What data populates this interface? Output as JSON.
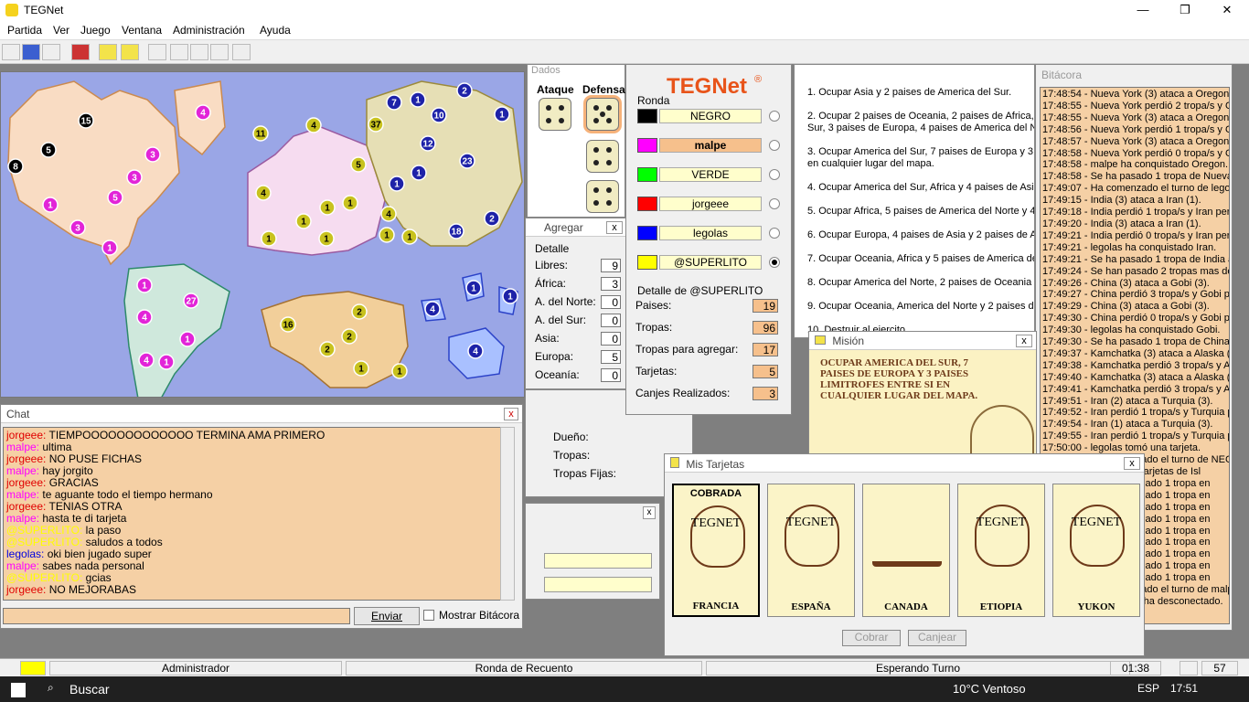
{
  "window": {
    "title": "TEGNet",
    "minimize": "—",
    "restore": "❐",
    "close": "✕"
  },
  "menu": [
    "Partida",
    "Ver",
    "Juego",
    "Ventana",
    "Administración",
    "Ayuda"
  ],
  "map": {
    "countries": [
      {
        "n": "15",
        "c": "black"
      },
      {
        "n": "5",
        "c": "black"
      },
      {
        "n": "8",
        "c": "black"
      },
      {
        "n": "4",
        "c": "magenta"
      },
      {
        "n": "3",
        "c": "magenta"
      },
      {
        "n": "3",
        "c": "magenta"
      },
      {
        "n": "5",
        "c": "magenta"
      },
      {
        "n": "1",
        "c": "magenta"
      },
      {
        "n": "3",
        "c": "magenta"
      },
      {
        "n": "1",
        "c": "magenta"
      },
      {
        "n": "1",
        "c": "magenta"
      },
      {
        "n": "27",
        "c": "magenta"
      },
      {
        "n": "4",
        "c": "magenta"
      },
      {
        "n": "1",
        "c": "magenta"
      },
      {
        "n": "4",
        "c": "magenta"
      },
      {
        "n": "1",
        "c": "magenta"
      },
      {
        "n": "11",
        "c": "yellow"
      },
      {
        "n": "4",
        "c": "yellow"
      },
      {
        "n": "37",
        "c": "yellow"
      },
      {
        "n": "5",
        "c": "yellow"
      },
      {
        "n": "4",
        "c": "yellow"
      },
      {
        "n": "1",
        "c": "yellow"
      },
      {
        "n": "1",
        "c": "yellow"
      },
      {
        "n": "1",
        "c": "yellow"
      },
      {
        "n": "1",
        "c": "yellow"
      },
      {
        "n": "1",
        "c": "yellow"
      },
      {
        "n": "4",
        "c": "yellow"
      },
      {
        "n": "1",
        "c": "yellow"
      },
      {
        "n": "1",
        "c": "yellow"
      },
      {
        "n": "16",
        "c": "yellow"
      },
      {
        "n": "2",
        "c": "yellow"
      },
      {
        "n": "2",
        "c": "yellow"
      },
      {
        "n": "2",
        "c": "yellow"
      },
      {
        "n": "1",
        "c": "yellow"
      },
      {
        "n": "1",
        "c": "yellow"
      },
      {
        "n": "7",
        "c": "blue"
      },
      {
        "n": "1",
        "c": "blue"
      },
      {
        "n": "2",
        "c": "blue"
      },
      {
        "n": "10",
        "c": "blue"
      },
      {
        "n": "1",
        "c": "blue"
      },
      {
        "n": "12",
        "c": "blue"
      },
      {
        "n": "23",
        "c": "blue"
      },
      {
        "n": "1",
        "c": "blue"
      },
      {
        "n": "1",
        "c": "blue"
      },
      {
        "n": "2",
        "c": "blue"
      },
      {
        "n": "18",
        "c": "blue"
      },
      {
        "n": "4",
        "c": "blue"
      },
      {
        "n": "1",
        "c": "blue"
      },
      {
        "n": "1",
        "c": "blue"
      },
      {
        "n": "4",
        "c": "blue"
      }
    ]
  },
  "chat": {
    "title": "Chat",
    "close": "x",
    "send_label": "Enviar",
    "show_log_label": "Mostrar Bitácora",
    "messages": [
      {
        "user": "jorgeee:",
        "color": "#e00000",
        "text": "TIEMPOOOOOOOOOOOOO TERMINA AMA PRIMERO"
      },
      {
        "user": "malpe:",
        "color": "#ff00ff",
        "text": "ultima"
      },
      {
        "user": "jorgeee:",
        "color": "#e00000",
        "text": "NO PUSE FICHAS"
      },
      {
        "user": "malpe:",
        "color": "#ff00ff",
        "text": "hay  jorgito"
      },
      {
        "user": "jorgeee:",
        "color": "#e00000",
        "text": "GRACIAS"
      },
      {
        "user": "malpe:",
        "color": "#ff00ff",
        "text": "te aguante todo el tiempo hermano"
      },
      {
        "user": "jorgeee:",
        "color": "#e00000",
        "text": "TENIAS OTRA"
      },
      {
        "user": "malpe:",
        "color": "#ff00ff",
        "text": "hasta te di tarjeta"
      },
      {
        "user": "@SUPERLITO:",
        "color": "#ffff00",
        "text": "la paso"
      },
      {
        "user": "@SUPERLITO:",
        "color": "#ffff00",
        "text": "saludos a todos"
      },
      {
        "user": "legolas:",
        "color": "#0000e0",
        "text": "oki bien jugado super"
      },
      {
        "user": "malpe:",
        "color": "#ff00ff",
        "text": "sabes nada personal"
      },
      {
        "user": "@SUPERLITO:",
        "color": "#ffff00",
        "text": "gcias"
      },
      {
        "user": "jorgeee:",
        "color": "#e00000",
        "text": "NO MEJORABAS"
      }
    ]
  },
  "dados": {
    "title": "Dados",
    "attack_label": "Ataque",
    "defense_label": "Defensa"
  },
  "agregar": {
    "title": "Agregar",
    "group_label": "Detalle",
    "rows": [
      {
        "label": "Libres:",
        "value": "9"
      },
      {
        "label": "África:",
        "value": "3"
      },
      {
        "label": "A. del Norte:",
        "value": "0"
      },
      {
        "label": "A. del Sur:",
        "value": "0"
      },
      {
        "label": "Asia:",
        "value": "0"
      },
      {
        "label": "Europa:",
        "value": "5"
      },
      {
        "label": "Oceanía:",
        "value": "0"
      }
    ]
  },
  "tegnet": {
    "logo": "TEGNet",
    "registered": "®",
    "ronda_label": "Ronda",
    "players": [
      {
        "name": "NEGRO",
        "color": "#000000",
        "active": false
      },
      {
        "name": "malpe",
        "color": "#ff00ff",
        "active": true
      },
      {
        "name": "VERDE",
        "color": "#00ff00",
        "active": false
      },
      {
        "name": "jorgeee",
        "color": "#ff0000",
        "active": false
      },
      {
        "name": "legolas",
        "color": "#0000ff",
        "active": false
      },
      {
        "name": "@SUPERLITO",
        "color": "#ffff00",
        "active": false
      }
    ],
    "detail_label": "Detalle de @SUPERLITO",
    "details": [
      {
        "label": "Paises:",
        "value": "19"
      },
      {
        "label": "Tropas:",
        "value": "96"
      },
      {
        "label": "Tropas para agregar:",
        "value": "17"
      },
      {
        "label": "Tarjetas:",
        "value": "5"
      },
      {
        "label": "Canjes Realizados:",
        "value": "3"
      }
    ]
  },
  "pais_panel": {
    "owner_label": "Dueño:",
    "troops_label": "Tropas:",
    "fixed_label": "Tropas Fijas:"
  },
  "objetivos": [
    "1. Ocupar Asia y 2 paises de America del Sur.",
    "2. Ocupar 2 paises de Oceania, 2 paises de Africa,",
    "Sur, 3 paises de Europa, 4 paises de America del N",
    "3. Ocupar America del Sur, 7 paises de Europa y 3 p",
    "en cualquier lugar del mapa.",
    "4. Ocupar America del Sur, Africa y 4 paises de Asia",
    "5. Ocupar Africa, 5 paises de America del Norte y 4",
    "6. Ocupar Europa, 4 paises de Asia y 2 paises de A",
    "7. Ocupar Oceania, Africa y 5 paises de America de",
    "8. Ocupar America del Norte, 2 paises de Oceania y",
    "9. Ocupar Oceania, America del Norte y 2 paises de",
    "10. Destruir al ejercito"
  ],
  "mision": {
    "title": "Misión",
    "close": "x",
    "text": "OCUPAR AMERICA DEL SUR, 7 PAISES DE EUROPA Y 3 PAISES LIMITROFES ENTRE SI EN CUALQUIER LUGAR DEL MAPA."
  },
  "tarjetas": {
    "title": "Mis Tarjetas",
    "close": "x",
    "cards": [
      {
        "name": "FRANCIA",
        "badge": "COBRADA",
        "art": "TEGNET",
        "selected": true
      },
      {
        "name": "ESPAÑA",
        "badge": "",
        "art": "TEGNET",
        "selected": false
      },
      {
        "name": "CANADA",
        "badge": "",
        "art": "",
        "selected": false
      },
      {
        "name": "ETIOPIA",
        "badge": "",
        "art": "TEGNET",
        "selected": false
      },
      {
        "name": "YUKON",
        "badge": "",
        "art": "TEGNET",
        "selected": false
      }
    ],
    "cobrar_label": "Cobrar",
    "canjear_label": "Canjear"
  },
  "bitacora": {
    "title": "Bitácora",
    "lines": [
      "17:48:54 - Nueva York (3) ataca a Oregon (",
      "17:48:55 - Nueva York perdió 2 tropa/s y Or",
      "17:48:55 - Nueva York (3) ataca a Oregon (2",
      "17:48:56 - Nueva York perdió 1 tropa/s y Or",
      "17:48:57 - Nueva York (3) ataca a Oregon (1",
      "17:48:58 - Nueva York perdió 0 tropa/s y Or",
      "17:48:58 - malpe ha conquistado Oregon.",
      "17:48:58 - Se ha pasado 1 tropa de Nueva Y",
      "17:49:07 - Ha comenzado el turno de legola",
      "17:49:15 - India (3) ataca a Iran (1).",
      "17:49:18 - India perdió 1 tropa/s y Iran perdi",
      "17:49:20 - India (3) ataca a Iran (1).",
      "17:49:21 - India perdió 0 tropa/s y Iran perdi",
      "17:49:21 - legolas ha conquistado Iran.",
      "17:49:21 - Se ha pasado 1 tropa de India a I",
      "17:49:24 - Se han pasado 2 tropas mas de I",
      "17:49:26 - China (3) ataca a Gobi (3).",
      "17:49:27 - China perdió 3 tropa/s y Gobi per",
      "17:49:29 - China (3) ataca a Gobi (3).",
      "17:49:30 - China perdió 0 tropa/s y Gobi per",
      "17:49:30 - legolas ha conquistado Gobi.",
      "17:49:30 - Se ha pasado 1 tropa de China a",
      "17:49:37 - Kamchatka (3) ataca a Alaska (3",
      "17:49:38 - Kamchatka perdió 3 tropa/s y Ala",
      "17:49:40 - Kamchatka (3) ataca a Alaska (3",
      "17:49:41 - Kamchatka perdió 3 tropa/s y Ala",
      "17:49:51 - Iran (2) ataca a Turquia (3).",
      "17:49:52 - Iran perdió 1 tropa/s y Turquia pe",
      "17:49:54 - Iran (1) ataca a Turquia (3).",
      "17:49:55 - Iran perdió 1 tropa/s y Turquia pe",
      "17:50:00 - legolas tomó una tarjeta.",
      "17:50:05 - Ha comenzado el turno de NEGR",
      "17:50:18 - Canjeo las tarjetas de Isl",
      "17:50:24 - Se ha agregado 1 tropa en",
      "17:50:25 - Se ha agregado 1 tropa en",
      "17:50:25 - Se ha agregado 1 tropa en",
      "17:50:26 - Se ha agregado 1 tropa en",
      "17:50:27 - Se ha agregado 1 tropa en",
      "17:50:27 - Se ha agregado 1 tropa en",
      "17:50:28 - Se ha agregado 1 tropa en",
      "17:50:28 - Se ha agregado 1 tropa en",
      "17:50:29 - Se ha agregado 1 tropa en",
      "17:50:29 - Ha comenzado el turno de malpe",
      "17:50:30 - NEGRO se ha desconectado."
    ]
  },
  "status": {
    "user": "Administrador",
    "round": "Ronda de Recuento",
    "state": "Esperando Turno",
    "time": "01:38",
    "count": "57"
  },
  "taskbar": {
    "search": "Buscar",
    "weather": "10°C  Ventoso",
    "lang": "ESP",
    "clock": "17:51"
  }
}
